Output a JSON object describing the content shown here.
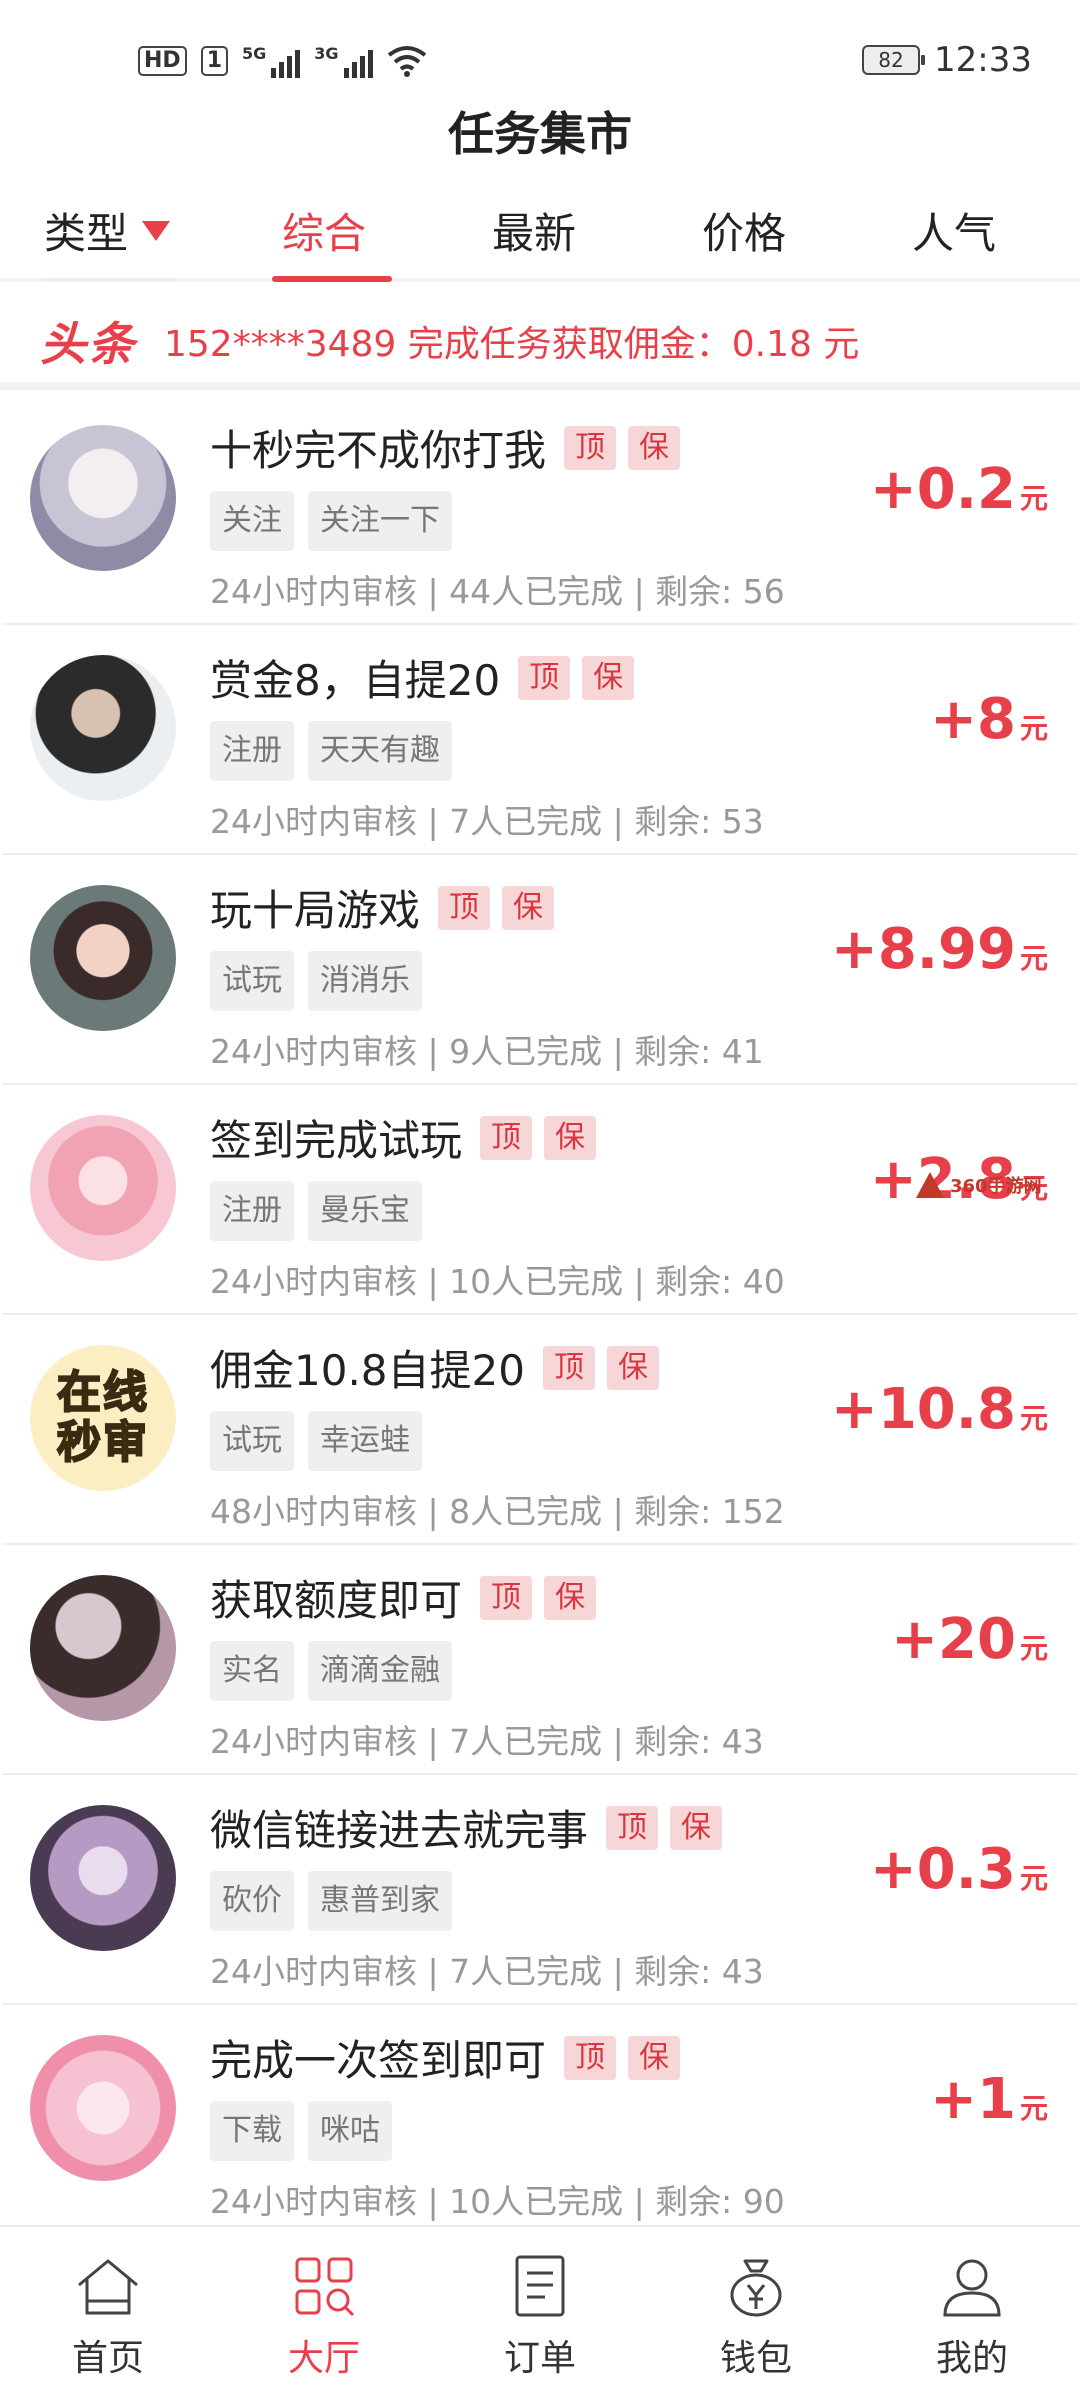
{
  "status_bar": {
    "hd": "HD",
    "sim": "1",
    "net1": "5G",
    "net2": "3G",
    "battery": "82",
    "time": "12:33"
  },
  "title": "任务集市",
  "tabs": {
    "type_label": "类型",
    "items": [
      "综合",
      "最新",
      "价格",
      "人气"
    ]
  },
  "ticker": {
    "logo": "头条",
    "text": "152****3489 完成任务获取佣金：0.18 元"
  },
  "task_tags": {
    "top": "顶",
    "guarantee": "保"
  },
  "tasks": [
    {
      "title": "十秒完不成你打我",
      "chips": [
        "关注",
        "关注一下"
      ],
      "meta": "24小时内审核 | 44人已完成 | 剩余: 56",
      "amount": "+0.2",
      "unit": "元"
    },
    {
      "title": "赏金8，自提20",
      "chips": [
        "注册",
        "天天有趣"
      ],
      "meta": "24小时内审核 | 7人已完成 | 剩余: 53",
      "amount": "+8",
      "unit": "元"
    },
    {
      "title": "玩十局游戏",
      "chips": [
        "试玩",
        "消消乐"
      ],
      "meta": "24小时内审核 | 9人已完成 | 剩余: 41",
      "amount": "+8.99",
      "unit": "元"
    },
    {
      "title": "签到完成试玩",
      "chips": [
        "注册",
        "曼乐宝"
      ],
      "meta": "24小时内审核 | 10人已完成 | 剩余: 40",
      "amount": "+2.8",
      "unit": "元"
    },
    {
      "title": "佣金10.8自提20",
      "chips": [
        "试玩",
        "幸运蛙"
      ],
      "meta": "48小时内审核 | 8人已完成 | 剩余: 152",
      "amount": "+10.8",
      "unit": "元",
      "avatar_text": [
        "在线",
        "秒审"
      ]
    },
    {
      "title": "获取额度即可",
      "chips": [
        "实名",
        "滴滴金融"
      ],
      "meta": "24小时内审核 | 7人已完成 | 剩余: 43",
      "amount": "+20",
      "unit": "元"
    },
    {
      "title": "微信链接进去就完事",
      "chips": [
        "砍价",
        "惠普到家"
      ],
      "meta": "24小时内审核 | 7人已完成 | 剩余: 43",
      "amount": "+0.3",
      "unit": "元"
    },
    {
      "title": "完成一次签到即可",
      "chips": [
        "下载",
        "咪咕"
      ],
      "meta": "24小时内审核 | 10人已完成 | 剩余: 90",
      "amount": "+1",
      "unit": "元"
    }
  ],
  "watermark": "360手游网",
  "bottom_nav": [
    {
      "label": "首页",
      "icon": "home-icon"
    },
    {
      "label": "大厅",
      "icon": "hall-icon"
    },
    {
      "label": "订单",
      "icon": "order-icon"
    },
    {
      "label": "钱包",
      "icon": "wallet-icon"
    },
    {
      "label": "我的",
      "icon": "profile-icon"
    }
  ],
  "colors": {
    "accent": "#e8404a",
    "tag_bg": "#f7d6d8",
    "chip_bg": "#efefef"
  }
}
